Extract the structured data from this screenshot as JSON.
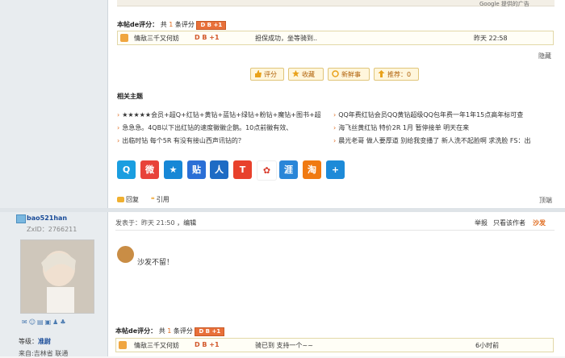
{
  "header_strip": {
    "google_text": "Google 提供的广告"
  },
  "post1": {
    "rating_head": {
      "label": "本帖de评分：",
      "count_prefix": "共",
      "count": "1",
      "count_suffix": "条评分",
      "db_badge": "D B +1"
    },
    "rating_row": {
      "user": "情敌三千又何妨",
      "db": "D B +1",
      "reason": "担保成功，坐等骑到..",
      "time": "昨天 22:58"
    },
    "hide_link": "隐藏",
    "buttons": [
      {
        "label": "评分",
        "icon": "thumbs-up-icon"
      },
      {
        "label": "收藏",
        "icon": "star-icon"
      },
      {
        "label": "新鲜事",
        "icon": "refresh-icon"
      },
      {
        "label": "推荐：0",
        "icon": "recommend-icon"
      }
    ],
    "related_title": "相关主题",
    "related_left": [
      "★★★★★会员+超Q+红钻+黄钻+蓝钻+绿钻+粉钻+魔钻+图书+超",
      "急急急。4QB以下出红钻的速度徽徽企鹅。10点前徽有效、",
      "出临时钻 每个5R 有没有接山西声讯钻的？"
    ],
    "related_right": [
      "QQ年费红钻会员QQ黄钻超级QQ包年费一年1年15点高年标可查",
      "海飞丝黄红钻 特价2R 1月  暂停接单 明天在来",
      "晨光老哥 做人要厚道 别给我变播了 新人洗不起脸啊 求洗脸 FS：出"
    ],
    "share_icons": [
      {
        "name": "qzone-share-icon",
        "glyph": "Q",
        "color": "#1a9ee0"
      },
      {
        "name": "weibo-share-icon",
        "glyph": "微",
        "color": "#e8423a"
      },
      {
        "name": "favorite-share-icon",
        "glyph": "★",
        "color": "#1787d6"
      },
      {
        "name": "tieba-share-icon",
        "glyph": "贴",
        "color": "#2b6fd6"
      },
      {
        "name": "renren-share-icon",
        "glyph": "人",
        "color": "#1e6bc4"
      },
      {
        "name": "tianya-share-icon",
        "glyph": "T",
        "color": "#e8412c"
      },
      {
        "name": "kaixin-share-icon",
        "glyph": "✿",
        "color": "#d83a2a"
      },
      {
        "name": "douban-share-icon",
        "glyph": "涯",
        "color": "#2a86d8"
      },
      {
        "name": "taobao-share-icon",
        "glyph": "淘",
        "color": "#f07a12"
      },
      {
        "name": "more-share-icon",
        "glyph": "+",
        "color": "#1d8ad8"
      }
    ],
    "reply_label": "回复",
    "quote_label": "引用",
    "top_link": "顶端"
  },
  "post2": {
    "username": "bao521han",
    "zxid": "ZxID：2766211",
    "meta": "发表于：昨天 21:50",
    "edit": "，编辑",
    "report": "举报",
    "only_author": "只看该作者",
    "floor": "沙发",
    "content": "沙发不留！",
    "level_label": "等级：",
    "level_value": "准尉",
    "location": "来自:吉林省 联通",
    "rating_head": {
      "label": "本帖de评分：",
      "count_prefix": "共",
      "count": "1",
      "count_suffix": "条评分",
      "db_badge": "D B +1"
    },
    "rating_row": {
      "user": "情敌三千又何妨",
      "db": "D B +1",
      "reason": "骑已到  支持一个~~",
      "time": "6小时前"
    }
  },
  "colors": {
    "accent": "#e06b1e",
    "link": "#1a4c99",
    "badge": "#e8703a"
  }
}
